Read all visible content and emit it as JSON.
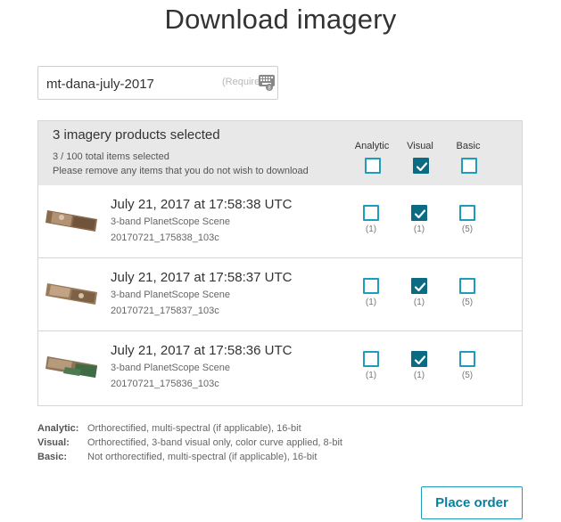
{
  "page": {
    "title": "Download imagery"
  },
  "order_name": {
    "value": "mt-dana-july-2017",
    "required_hint": "(Required)"
  },
  "selection": {
    "title": "3 imagery products selected",
    "count_text": "3 / 100 total items selected",
    "note": "Please remove any items that you do not wish to download",
    "columns": [
      "Analytic",
      "Visual",
      "Basic"
    ],
    "column_checked": [
      false,
      true,
      false
    ]
  },
  "items": [
    {
      "title": "July 21, 2017 at 17:58:38 UTC",
      "subtitle": "3-band PlanetScope Scene",
      "id": "20170721_175838_103c",
      "checked": [
        false,
        true,
        false
      ],
      "counts": [
        "(1)",
        "(1)",
        "(5)"
      ]
    },
    {
      "title": "July 21, 2017 at 17:58:37 UTC",
      "subtitle": "3-band PlanetScope Scene",
      "id": "20170721_175837_103c",
      "checked": [
        false,
        true,
        false
      ],
      "counts": [
        "(1)",
        "(1)",
        "(5)"
      ]
    },
    {
      "title": "July 21, 2017 at 17:58:36 UTC",
      "subtitle": "3-band PlanetScope Scene",
      "id": "20170721_175836_103c",
      "checked": [
        false,
        true,
        false
      ],
      "counts": [
        "(1)",
        "(1)",
        "(5)"
      ]
    }
  ],
  "legend": [
    {
      "term": "Analytic:",
      "desc": "Orthorectified, multi-spectral (if applicable), 16-bit"
    },
    {
      "term": "Visual:",
      "desc": "Orthorectified, 3-band visual only, color curve applied, 8-bit"
    },
    {
      "term": "Basic:",
      "desc": "Not orthorectified, multi-spectral (if applicable), 16-bit"
    }
  ],
  "actions": {
    "place_order": "Place order"
  },
  "colors": {
    "accent": "#1e9bbd",
    "checked": "#0b6b83",
    "header_bg": "#e8e8e8"
  },
  "icons": {
    "keyboard": "keyboard-icon",
    "check": "checkmark-icon"
  }
}
